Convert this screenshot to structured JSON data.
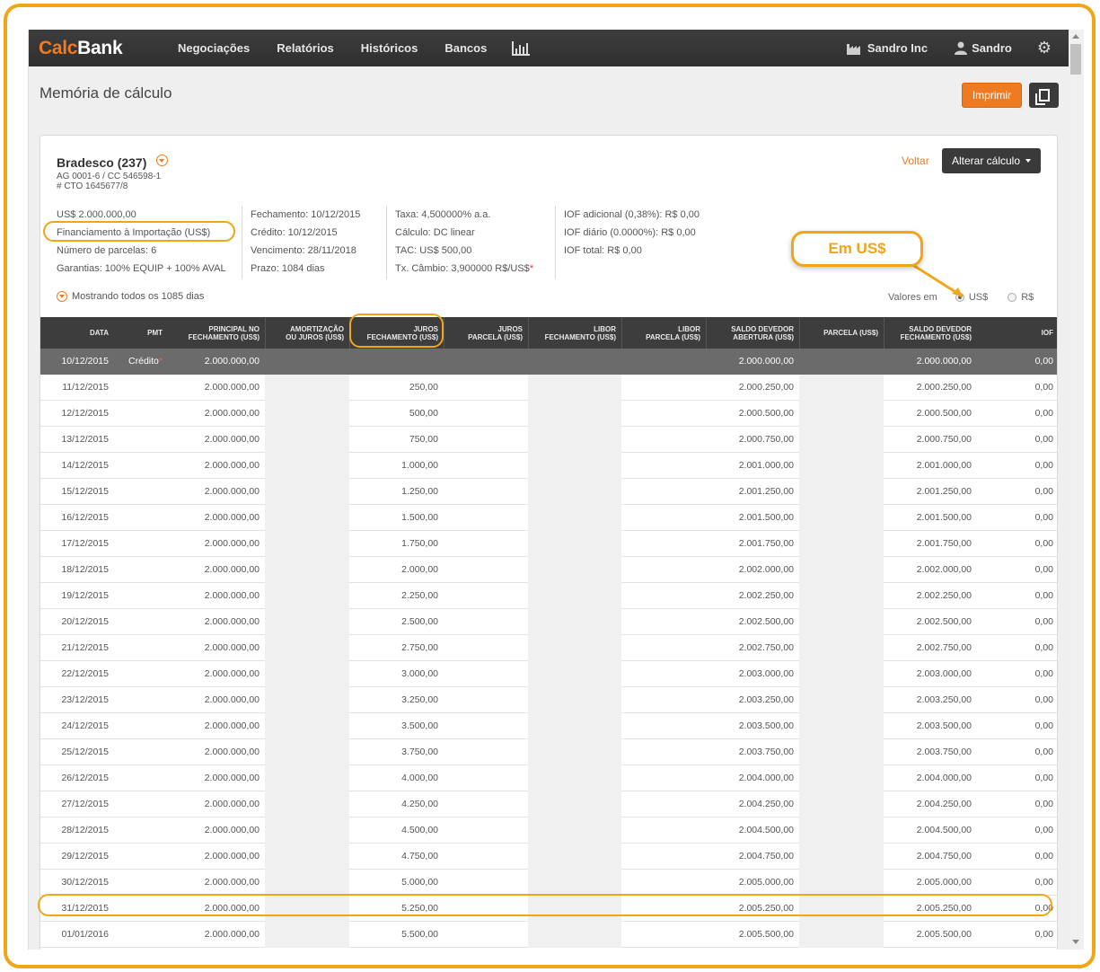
{
  "brand": {
    "part1": "Calc",
    "part2": "Bank"
  },
  "nav": {
    "items": [
      "Negociações",
      "Relatórios",
      "Históricos",
      "Bancos"
    ],
    "company": "Sandro Inc",
    "user": "Sandro"
  },
  "page": {
    "title": "Memória de cálculo",
    "print_label": "Imprimir"
  },
  "bank": {
    "name": "Bradesco (237)",
    "ag_cc": "AG 0001-6 / CC 546598-1",
    "cto": "# CTO 1645677/8",
    "back_label": "Voltar",
    "alter_label": "Alterar cálculo"
  },
  "info": {
    "col1": [
      "US$ 2.000.000,00",
      "Financiamento à Importação (US$)",
      "Número de parcelas: 6",
      "Garantias: 100% EQUIP + 100% AVAL"
    ],
    "col2": [
      "Fechamento: 10/12/2015",
      "Crédito: 10/12/2015",
      "Vencimento: 28/11/2018",
      "Prazo: 1084 dias"
    ],
    "col3": [
      "Taxa: 4,500000% a.a.",
      "Cálculo: DC linear",
      "TAC: US$ 500,00",
      "Tx. Câmbio: 3,900000 R$/US$"
    ],
    "col3_asterisk": "*",
    "col4": [
      "IOF adicional (0,38%): R$ 0,00",
      "IOF diário (0.0000%): R$ 0,00",
      "IOF total: R$ 0,00"
    ]
  },
  "showing": "Mostrando todos os 1085 dias",
  "valores": {
    "label": "Valores em",
    "opt_usd": "US$",
    "opt_brl": "R$",
    "selected": "US$"
  },
  "callout": "Em US$",
  "table": {
    "headers": [
      "DATA",
      "PMT",
      "PRINCIPAL NO\nFECHAMENTO (US$)",
      "AMORTIZAÇÃO\nOU JUROS (US$)",
      "JUROS\nFECHAMENTO (US$)",
      "JUROS\nPARCELA (US$)",
      "LIBOR\nFECHAMENTO (US$)",
      "LIBOR\nPARCELA (US$)",
      "SALDO DEVEDOR\nABERTURA (US$)",
      "PARCELA (US$)",
      "SALDO DEVEDOR\nFECHAMENTO (US$)",
      "IOF"
    ],
    "first_row": {
      "date": "10/12/2015",
      "pmt": "Crédito",
      "pmt_mark": "*",
      "principal": "2.000.000,00",
      "saldo_ab": "2.000.000,00",
      "saldo_fe": "2.000.000,00",
      "iof": "0,00"
    },
    "rows": [
      [
        "11/12/2015",
        "2.000.000,00",
        "250,00",
        "2.000.250,00",
        "2.000.250,00",
        "0,00"
      ],
      [
        "12/12/2015",
        "2.000.000,00",
        "500,00",
        "2.000.500,00",
        "2.000.500,00",
        "0,00"
      ],
      [
        "13/12/2015",
        "2.000.000,00",
        "750,00",
        "2.000.750,00",
        "2.000.750,00",
        "0,00"
      ],
      [
        "14/12/2015",
        "2.000.000,00",
        "1.000,00",
        "2.001.000,00",
        "2.001.000,00",
        "0,00"
      ],
      [
        "15/12/2015",
        "2.000.000,00",
        "1.250,00",
        "2.001.250,00",
        "2.001.250,00",
        "0,00"
      ],
      [
        "16/12/2015",
        "2.000.000,00",
        "1.500,00",
        "2.001.500,00",
        "2.001.500,00",
        "0,00"
      ],
      [
        "17/12/2015",
        "2.000.000,00",
        "1.750,00",
        "2.001.750,00",
        "2.001.750,00",
        "0,00"
      ],
      [
        "18/12/2015",
        "2.000.000,00",
        "2.000,00",
        "2.002.000,00",
        "2.002.000,00",
        "0,00"
      ],
      [
        "19/12/2015",
        "2.000.000,00",
        "2.250,00",
        "2.002.250,00",
        "2.002.250,00",
        "0,00"
      ],
      [
        "20/12/2015",
        "2.000.000,00",
        "2.500,00",
        "2.002.500,00",
        "2.002.500,00",
        "0,00"
      ],
      [
        "21/12/2015",
        "2.000.000,00",
        "2.750,00",
        "2.002.750,00",
        "2.002.750,00",
        "0,00"
      ],
      [
        "22/12/2015",
        "2.000.000,00",
        "3.000,00",
        "2.003.000,00",
        "2.003.000,00",
        "0,00"
      ],
      [
        "23/12/2015",
        "2.000.000,00",
        "3.250,00",
        "2.003.250,00",
        "2.003.250,00",
        "0,00"
      ],
      [
        "24/12/2015",
        "2.000.000,00",
        "3.500,00",
        "2.003.500,00",
        "2.003.500,00",
        "0,00"
      ],
      [
        "25/12/2015",
        "2.000.000,00",
        "3.750,00",
        "2.003.750,00",
        "2.003.750,00",
        "0,00"
      ],
      [
        "26/12/2015",
        "2.000.000,00",
        "4.000,00",
        "2.004.000,00",
        "2.004.000,00",
        "0,00"
      ],
      [
        "27/12/2015",
        "2.000.000,00",
        "4.250,00",
        "2.004.250,00",
        "2.004.250,00",
        "0,00"
      ],
      [
        "28/12/2015",
        "2.000.000,00",
        "4.500,00",
        "2.004.500,00",
        "2.004.500,00",
        "0,00"
      ],
      [
        "29/12/2015",
        "2.000.000,00",
        "4.750,00",
        "2.004.750,00",
        "2.004.750,00",
        "0,00"
      ],
      [
        "30/12/2015",
        "2.000.000,00",
        "5.000,00",
        "2.005.000,00",
        "2.005.000,00",
        "0,00"
      ],
      [
        "31/12/2015",
        "2.000.000,00",
        "5.250,00",
        "2.005.250,00",
        "2.005.250,00",
        "0,00"
      ],
      [
        "01/01/2016",
        "2.000.000,00",
        "5.500,00",
        "2.005.500,00",
        "2.005.500,00",
        "0,00"
      ]
    ]
  },
  "colors": {
    "accent": "#ee7a21",
    "highlight": "#f0a616",
    "nav_bg": "#333333"
  }
}
